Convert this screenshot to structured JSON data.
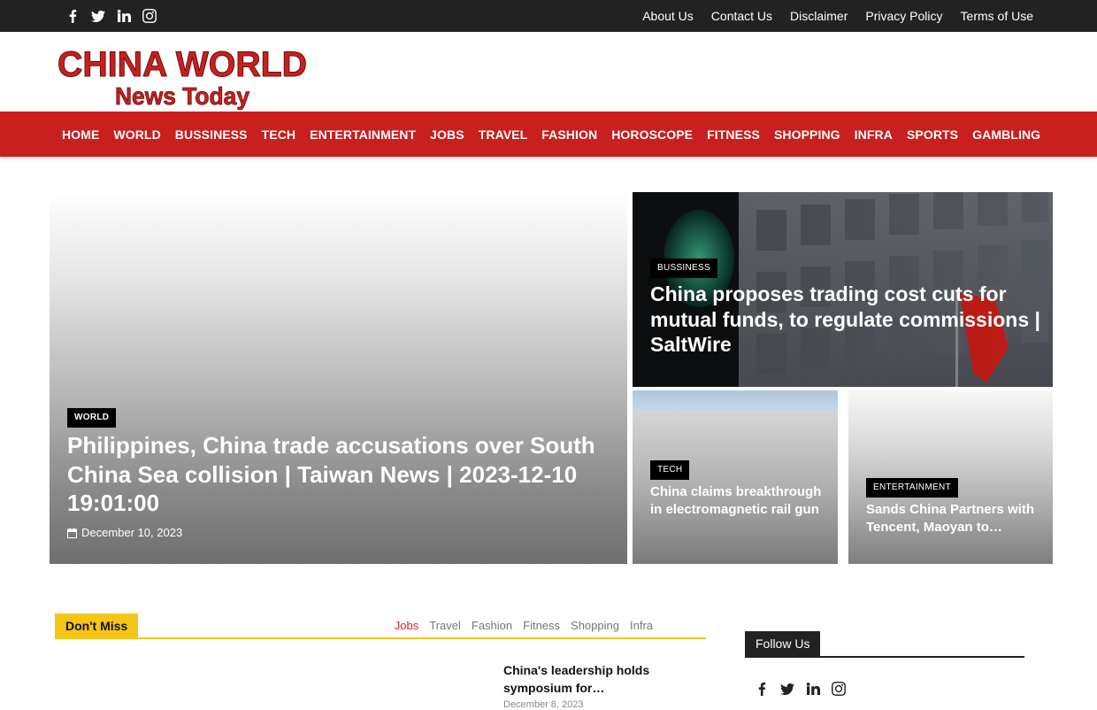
{
  "topbar": {
    "social_icons": [
      "facebook-icon",
      "twitter-icon",
      "linkedin-icon",
      "instagram-icon"
    ],
    "links": [
      "About Us",
      "Contact Us",
      "Disclaimer",
      "Privacy Policy",
      "Terms of Use"
    ]
  },
  "logo": {
    "line1": "CHINA WORLD",
    "line2": "News Today"
  },
  "nav": {
    "items": [
      "HOME",
      "WORLD",
      "BUSSINESS",
      "TECH",
      "ENTERTAINMENT",
      "JOBS",
      "TRAVEL",
      "FASHION",
      "HOROSCOPE",
      "FITNESS",
      "SHOPPING",
      "INFRA",
      "SPORTS",
      "GAMBLING"
    ]
  },
  "featured": {
    "main": {
      "category": "World",
      "title": "Philippines, China trade accusations over South China Sea collision | Taiwan News | 2023-12-10 19:01:00",
      "date": "December 10, 2023"
    },
    "top_right": {
      "category": "Bussiness",
      "title": "China proposes trading cost cuts for mutual funds, to regulate commissions | SaltWire"
    },
    "bottom_left": {
      "category": "Tech",
      "title": "China claims breakthrough in electromagnetic rail gun"
    },
    "bottom_right": {
      "category": "Entertainment",
      "title": "Sands China Partners with Tencent, Maoyan to…"
    }
  },
  "dont_miss": {
    "label": "Don't Miss",
    "tabs": [
      "Jobs",
      "Travel",
      "Fashion",
      "Fitness",
      "Shopping",
      "Infra"
    ],
    "active_tab": "Jobs",
    "story": {
      "title": "China's leadership holds symposium for…",
      "date": "December 8, 2023"
    }
  },
  "follow": {
    "label": "Follow Us",
    "social_icons": [
      "facebook-icon",
      "twitter-icon",
      "linkedin-icon",
      "instagram-icon"
    ]
  },
  "colors": {
    "topbar": "#222222",
    "nav": "#c81f1f",
    "accent_yellow": "#f5c518",
    "active_tab": "#e02020"
  }
}
